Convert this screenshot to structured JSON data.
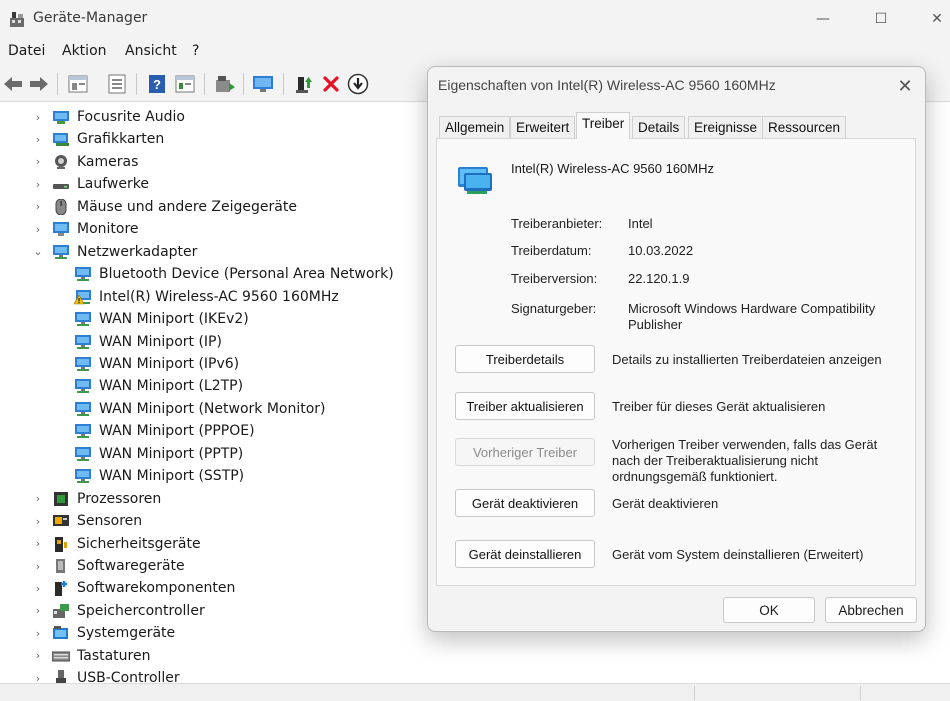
{
  "window": {
    "title": "Geräte-Manager",
    "controls": {
      "minimize": "—",
      "maximize": "☐",
      "close": "✕"
    }
  },
  "menu": [
    "Datei",
    "Aktion",
    "Ansicht",
    "?"
  ],
  "toolbar": {
    "buttons": [
      "back-icon",
      "forward-icon",
      "properties-icon",
      "list-icon",
      "help-icon",
      "view-icon",
      "scan-icon",
      "monitor-icon",
      "update-driver-icon",
      "uninstall-icon",
      "download-icon"
    ]
  },
  "tree": [
    {
      "label": "Focusrite Audio",
      "chev": "›",
      "icon": "audio-icon"
    },
    {
      "label": "Grafikkarten",
      "chev": "›",
      "icon": "display-adapter-icon"
    },
    {
      "label": "Kameras",
      "chev": "›",
      "icon": "camera-icon"
    },
    {
      "label": "Laufwerke",
      "chev": "›",
      "icon": "drive-icon"
    },
    {
      "label": "Mäuse und andere Zeigegeräte",
      "chev": "›",
      "icon": "mouse-icon"
    },
    {
      "label": "Monitore",
      "chev": "›",
      "icon": "monitor-icon"
    },
    {
      "label": "Netzwerkadapter",
      "chev": "⌄",
      "icon": "network-icon"
    },
    {
      "label": "Bluetooth Device (Personal Area Network)",
      "chev": "",
      "icon": "network-icon",
      "child": true
    },
    {
      "label": "Intel(R) Wireless-AC 9560 160MHz",
      "chev": "",
      "icon": "warning-network-icon",
      "child": true
    },
    {
      "label": "WAN Miniport (IKEv2)",
      "chev": "",
      "icon": "network-icon",
      "child": true
    },
    {
      "label": "WAN Miniport (IP)",
      "chev": "",
      "icon": "network-icon",
      "child": true
    },
    {
      "label": "WAN Miniport (IPv6)",
      "chev": "",
      "icon": "network-icon",
      "child": true
    },
    {
      "label": "WAN Miniport (L2TP)",
      "chev": "",
      "icon": "network-icon",
      "child": true
    },
    {
      "label": "WAN Miniport (Network Monitor)",
      "chev": "",
      "icon": "network-icon",
      "child": true
    },
    {
      "label": "WAN Miniport (PPPOE)",
      "chev": "",
      "icon": "network-icon",
      "child": true
    },
    {
      "label": "WAN Miniport (PPTP)",
      "chev": "",
      "icon": "network-icon",
      "child": true
    },
    {
      "label": "WAN Miniport (SSTP)",
      "chev": "",
      "icon": "network-icon",
      "child": true
    },
    {
      "label": "Prozessoren",
      "chev": "›",
      "icon": "processor-icon"
    },
    {
      "label": "Sensoren",
      "chev": "›",
      "icon": "sensor-icon"
    },
    {
      "label": "Sicherheitsgeräte",
      "chev": "›",
      "icon": "security-icon"
    },
    {
      "label": "Softwaregeräte",
      "chev": "›",
      "icon": "software-device-icon"
    },
    {
      "label": "Softwarekomponenten",
      "chev": "›",
      "icon": "software-component-icon"
    },
    {
      "label": "Speichercontroller",
      "chev": "›",
      "icon": "storage-controller-icon"
    },
    {
      "label": "Systemgeräte",
      "chev": "›",
      "icon": "system-device-icon"
    },
    {
      "label": "Tastaturen",
      "chev": "›",
      "icon": "keyboard-icon"
    },
    {
      "label": "USB-Controller",
      "chev": "›",
      "icon": "usb-icon"
    }
  ],
  "dialog": {
    "title": "Eigenschaften von Intel(R) Wireless-AC 9560 160MHz",
    "close": "✕",
    "tabs": [
      "Allgemein",
      "Erweitert",
      "Treiber",
      "Details",
      "Ereignisse",
      "Ressourcen"
    ],
    "active_tab": "Treiber",
    "device_name": "Intel(R) Wireless-AC 9560 160MHz",
    "properties": [
      {
        "label": "Treiberanbieter:",
        "value": "Intel"
      },
      {
        "label": "Treiberdatum:",
        "value": "10.03.2022"
      },
      {
        "label": "Treiberversion:",
        "value": "22.120.1.9"
      },
      {
        "label": "Signaturgeber:",
        "value": "Microsoft Windows Hardware Compatibility Publisher"
      }
    ],
    "actions": [
      {
        "button": "Treiberdetails",
        "description": "Details zu installierten Treiberdateien anzeigen",
        "enabled": true
      },
      {
        "button": "Treiber aktualisieren",
        "description": "Treiber für dieses Gerät aktualisieren",
        "enabled": true
      },
      {
        "button": "Vorheriger Treiber",
        "description": "Vorherigen Treiber verwenden, falls das Gerät nach der Treiberaktualisierung nicht ordnungsgemäß funktioniert.",
        "enabled": false
      },
      {
        "button": "Gerät deaktivieren",
        "description": "Gerät deaktivieren",
        "enabled": true
      },
      {
        "button": "Gerät deinstallieren",
        "description": "Gerät vom System deinstallieren (Erweitert)",
        "enabled": true
      }
    ],
    "ok": "OK",
    "cancel": "Abbrechen"
  },
  "colors": {
    "accent_blue": "#1f7ad6",
    "warning_yellow": "#f2c200",
    "delete_red": "#e81123",
    "chrome": "#f3f3f3"
  }
}
